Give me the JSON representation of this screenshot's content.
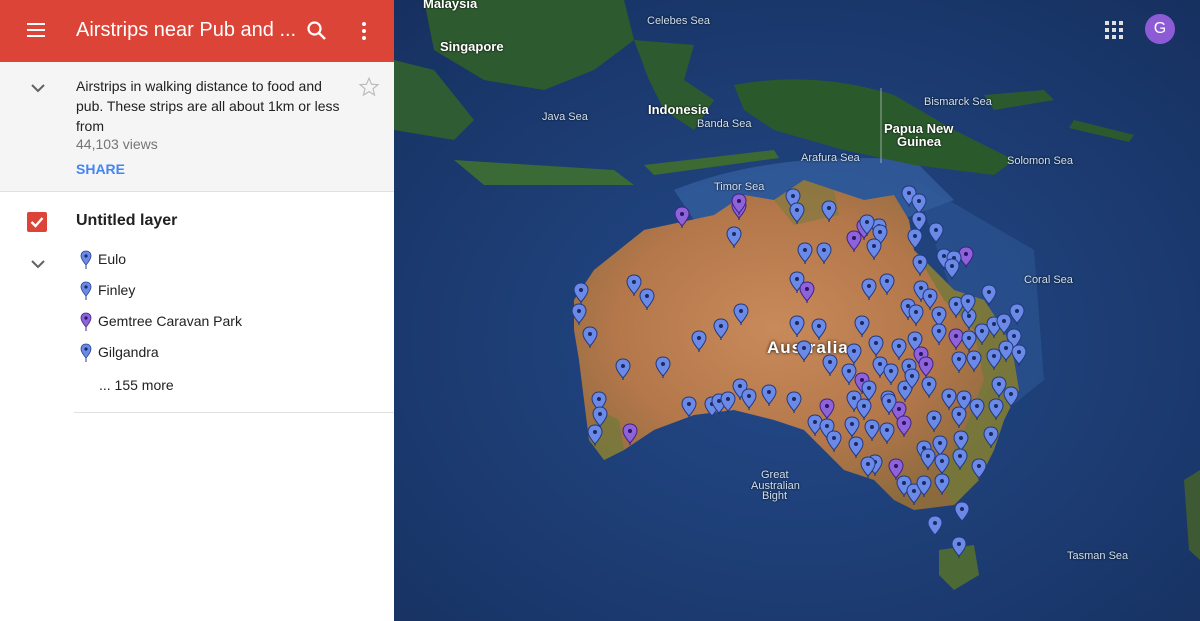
{
  "header": {
    "title": "Airstrips near Pub and ...",
    "menu_icon": "hamburger-menu-icon",
    "search_icon": "search-icon",
    "more_icon": "more-vert-icon",
    "color": "#db4437"
  },
  "map_info": {
    "description": "Airstrips in walking distance to food and pub. These strips are all about 1km or less from",
    "views": "44,103 views",
    "share_label": "SHARE"
  },
  "layer": {
    "name": "Untitled layer",
    "items": [
      {
        "label": "Eulo",
        "pin_color": "#6b8ae8"
      },
      {
        "label": "Finley",
        "pin_color": "#6b8ae8"
      },
      {
        "label": "Gemtree Caravan Park",
        "pin_color": "#8e62d8"
      },
      {
        "label": "Gilgandra",
        "pin_color": "#6b8ae8"
      }
    ],
    "more_label": "... 155 more"
  },
  "map": {
    "labels": {
      "malaysia": "Malaysia",
      "singapore": "Singapore",
      "celebes_sea": "Celebes Sea",
      "indonesia": "Indonesia",
      "java_sea": "Java Sea",
      "banda_sea": "Banda Sea",
      "bismarck_sea": "Bismarck Sea",
      "papua_new_guinea_1": "Papua New",
      "papua_new_guinea_2": "Guinea",
      "arafura_sea": "Arafura Sea",
      "solomon_sea": "Solomon Sea",
      "timor_sea": "Timor Sea",
      "coral_sea": "Coral Sea",
      "australia": "Australia",
      "great_australian_bight_1": "Great",
      "great_australian_bight_2": "Australian",
      "great_australian_bight_3": "Bight",
      "tasman_sea": "Tasman Sea"
    },
    "pin_colors": {
      "default": "#6b8ae8",
      "alt": "#8e62d8"
    },
    "apps_icon": "apps-grid-icon",
    "avatar_letter": "G"
  }
}
